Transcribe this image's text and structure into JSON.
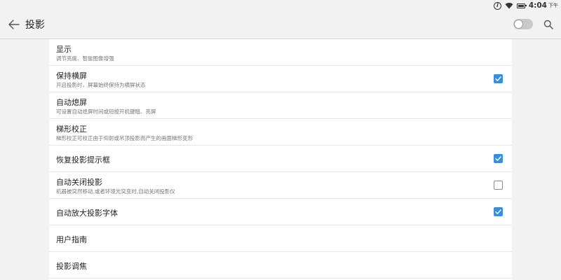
{
  "status_bar": {
    "time": "4:04",
    "ampm": "下午",
    "icons": [
      "info-icon",
      "wifi-icon",
      "battery-icon"
    ]
  },
  "header": {
    "title": "投影",
    "back_icon": "arrow-left-icon",
    "toggle_on": false,
    "search_icon": "search-icon"
  },
  "settings": [
    {
      "title": "显示",
      "subtitle": "调节亮度、智能图像增强",
      "checkbox": null
    },
    {
      "title": "保持横屏",
      "subtitle": "开启投影时，屏幕始终保持为横屏状态",
      "checkbox": true
    },
    {
      "title": "自动熄屏",
      "subtitle": "可设置自动熄屏时间或短按开机键暗、亮屏",
      "checkbox": null
    },
    {
      "title": "梯形校正",
      "subtitle": "梯形校正可校正由于仰射或吊顶投影而产生的画面梯形变形",
      "checkbox": null
    },
    {
      "title": "恢复投影提示框",
      "subtitle": "",
      "checkbox": true
    },
    {
      "title": "自动关闭投影",
      "subtitle": "机器被突然移动,或者环境光突变时,自动关闭投影仪",
      "checkbox": false
    },
    {
      "title": "自动放大投影字体",
      "subtitle": "",
      "checkbox": true
    },
    {
      "title": "用户指南",
      "subtitle": "",
      "checkbox": null
    },
    {
      "title": "投影调焦",
      "subtitle": "",
      "checkbox": null
    }
  ],
  "colors": {
    "accent": "#3d8ed8",
    "background": "#f2f2f2",
    "card": "#ffffff"
  }
}
